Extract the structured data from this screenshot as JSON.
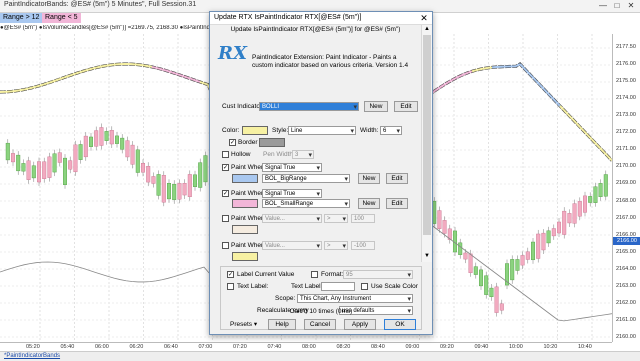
{
  "window": {
    "title": "PaintIndicatorBands: @ES# (5m\") 5 Minutes\", Full Session.31",
    "controls": [
      "—",
      "□",
      "✕"
    ]
  },
  "range_filters": [
    {
      "label": "Range > 12",
      "color": "#a9c8f0"
    },
    {
      "label": "Range < 5",
      "color": "#f2b6d8"
    }
  ],
  "series_info": "●@ES# (5m\") ●IsVolumeCandles[@ES# (5m\")] =2169.75, 2168.30 ●IsPaintIndicator RTX[@ES# (5m\")]",
  "y_axis": {
    "labels": [
      "2177.50",
      "2176.00",
      "2175.00",
      "2174.00",
      "2173.00",
      "2172.00",
      "2171.00",
      "2170.00",
      "2169.00",
      "2168.00",
      "2167.00",
      "2166.00",
      "2165.00",
      "2164.00",
      "2163.00",
      "2162.00",
      "2161.00",
      "2160.00"
    ],
    "current_price": "2166.00"
  },
  "x_axis": {
    "labels": [
      "05:20",
      "05:40",
      "06:00",
      "06:20",
      "06:40",
      "07:00",
      "07:20",
      "07:40",
      "08:00",
      "08:20",
      "08:40",
      "09:00",
      "09:20",
      "09:40",
      "10:00",
      "10:20",
      "10:40"
    ]
  },
  "status_tab": "*PaintIndicatorBands",
  "dialog": {
    "title": "Update RTX IsPaintIndicator RTX[@ES# (5m\")]",
    "subtitle": "Update IsPaintIndicator RTX[@ES# (5m\")] for @ES# (5m\")",
    "logo": "RX",
    "description": "PaintIndicator Extension: Paint Indicator - Paints a custom indicator based on various criteria. Version 1.4",
    "cust_indicator_label": "Cust Indicator:",
    "cust_indicator_value": "BOLLI",
    "new_label": "New",
    "edit_label": "Edit",
    "color_label": "Color:",
    "color_value": "#f7f1a3",
    "style_label": "Style:",
    "style_value": "Line",
    "width_label": "Width:",
    "width_value": "6",
    "border_label": "Border",
    "border_color": "#9a9a9a",
    "hollow_label": "Hollow",
    "pen_width_label": "Pen Width:",
    "pen_width_value": "3",
    "paint_when_label": "Paint When",
    "paint_rows": [
      {
        "checked": true,
        "condition": "Signal True",
        "swatch": "#a9c8f0",
        "indicator": "BOL_BigRange",
        "op": "",
        "value": "",
        "enabled": true
      },
      {
        "checked": true,
        "condition": "Signal True",
        "swatch": "#f2b6d8",
        "indicator": "BOL_SmallRange",
        "op": "",
        "value": "",
        "enabled": true
      },
      {
        "checked": false,
        "condition": "Value...",
        "swatch": "#f5ece0",
        "indicator": "Value...",
        "op": ">",
        "value": "100",
        "enabled": false
      },
      {
        "checked": false,
        "condition": "Value...",
        "swatch": "#f7f1a3",
        "indicator": "Value...",
        "op": ">",
        "value": "-100",
        "enabled": false
      }
    ],
    "label_current_value": "Label Current Value",
    "format_label": "Format:",
    "format_value": "95",
    "text_label_check": "Text Label:",
    "text_label_field_label": "Text Label:",
    "use_scale_color": "Use Scale Color",
    "scope_label": "Scope:",
    "scope_value": "This Chart, Any Instrument",
    "recalculate_label": "Recalculate every",
    "recalculate_value": "use defaults",
    "calc_info": "Calc'd 10 times (0ms)",
    "buttons": {
      "presets": "Presets",
      "help": "Help",
      "cancel": "Cancel",
      "apply": "Apply",
      "ok": "OK"
    }
  }
}
